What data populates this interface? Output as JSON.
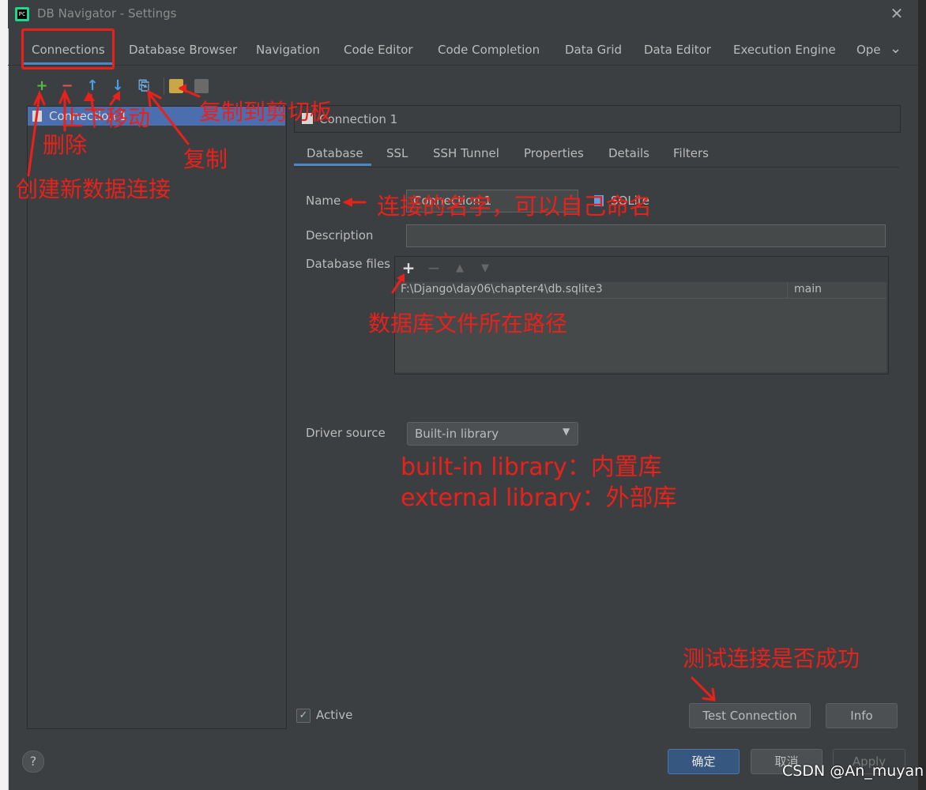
{
  "window": {
    "title": "DB Navigator - Settings",
    "app_icon_text": "PC"
  },
  "tabs": [
    {
      "label": "Connections",
      "active": true
    },
    {
      "label": "Database Browser"
    },
    {
      "label": "Navigation"
    },
    {
      "label": "Code Editor"
    },
    {
      "label": "Code Completion"
    },
    {
      "label": "Data Grid"
    },
    {
      "label": "Data Editor"
    },
    {
      "label": "Execution Engine"
    },
    {
      "label": "Ope"
    }
  ],
  "toolbar": {
    "add": "+",
    "remove": "−",
    "up": "↑",
    "down": "↓",
    "copy": "⎘"
  },
  "connections": [
    {
      "label": "Connection 1",
      "selected": true
    }
  ],
  "connection_header": "Connection 1",
  "subtabs": [
    {
      "label": "Database",
      "active": true
    },
    {
      "label": "SSL"
    },
    {
      "label": "SSH Tunnel"
    },
    {
      "label": "Properties"
    },
    {
      "label": "Details"
    },
    {
      "label": "Filters"
    }
  ],
  "form": {
    "name_label": "Name",
    "name_value": "Connection 1",
    "db_type": "SQLite",
    "description_label": "Description",
    "description_value": "",
    "db_files_label": "Database files",
    "files": [
      {
        "path": "F:\\Django\\day06\\chapter4\\db.sqlite3",
        "schema": "main"
      }
    ],
    "driver_source_label": "Driver source",
    "driver_source_value": "Built-in library"
  },
  "bottom": {
    "active_label": "Active",
    "active_checked": true,
    "test_connection": "Test Connection",
    "info": "Info",
    "ok": "确定",
    "cancel": "取消",
    "apply": "Apply",
    "help": "?"
  },
  "annotations": {
    "move": "上下移动",
    "copy_to_clipboard": "复制到剪切板",
    "delete": "删除",
    "copy": "复制",
    "create_new": "创建新数据连接",
    "name_hint": "连接的名字，可以自己命名",
    "files_hint": "数据库文件所在路径",
    "builtin_hint": "built-in library：内置库",
    "external_hint": "external library：外部库",
    "test_hint": "测试连接是否成功"
  },
  "watermark": "CSDN @An_muyan",
  "colors": {
    "background": "#3c3f41",
    "accent": "#4a88c7",
    "selection": "#4b6eaf",
    "annotation": "#e8211b",
    "add_icon": "#4fbf40",
    "remove_icon": "#e05555",
    "move_icon": "#4a9fe8"
  }
}
